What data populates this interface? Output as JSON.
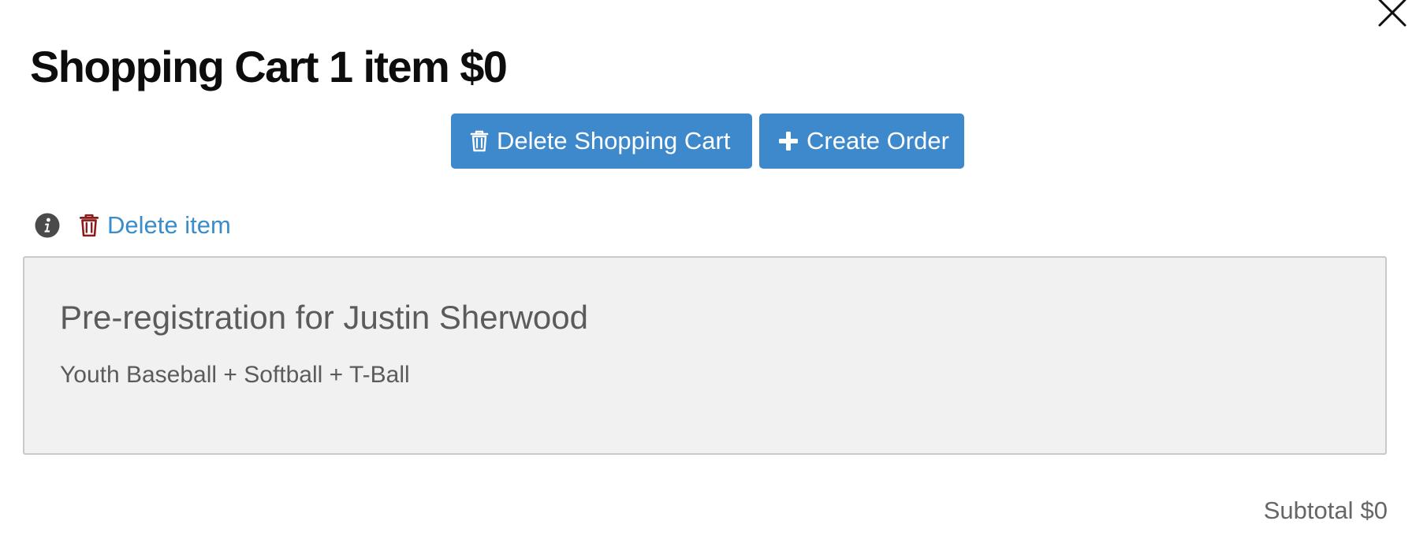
{
  "modal": {
    "close_icon": "close-icon"
  },
  "header": {
    "title": "Shopping Cart",
    "item_count": "1 item",
    "total": "$0"
  },
  "actions": {
    "delete_cart_label": "Delete Shopping Cart",
    "delete_cart_icon": "trash-icon",
    "create_order_label": "Create Order",
    "create_order_icon": "plus-icon"
  },
  "item_toolbar": {
    "info_icon": "info-icon",
    "delete_icon": "trash-icon",
    "delete_label": "Delete item"
  },
  "cart_items": [
    {
      "title": "Pre-registration for Justin Sherwood",
      "description": "Youth Baseball + Softball + T-Ball"
    }
  ],
  "summary": {
    "subtotal_label": "Subtotal",
    "subtotal_value": "$0"
  },
  "colors": {
    "primary_button": "#3d89cc",
    "link": "#3a8dc9",
    "danger_icon": "#8b1a1a",
    "item_background": "#f1f1f1"
  }
}
